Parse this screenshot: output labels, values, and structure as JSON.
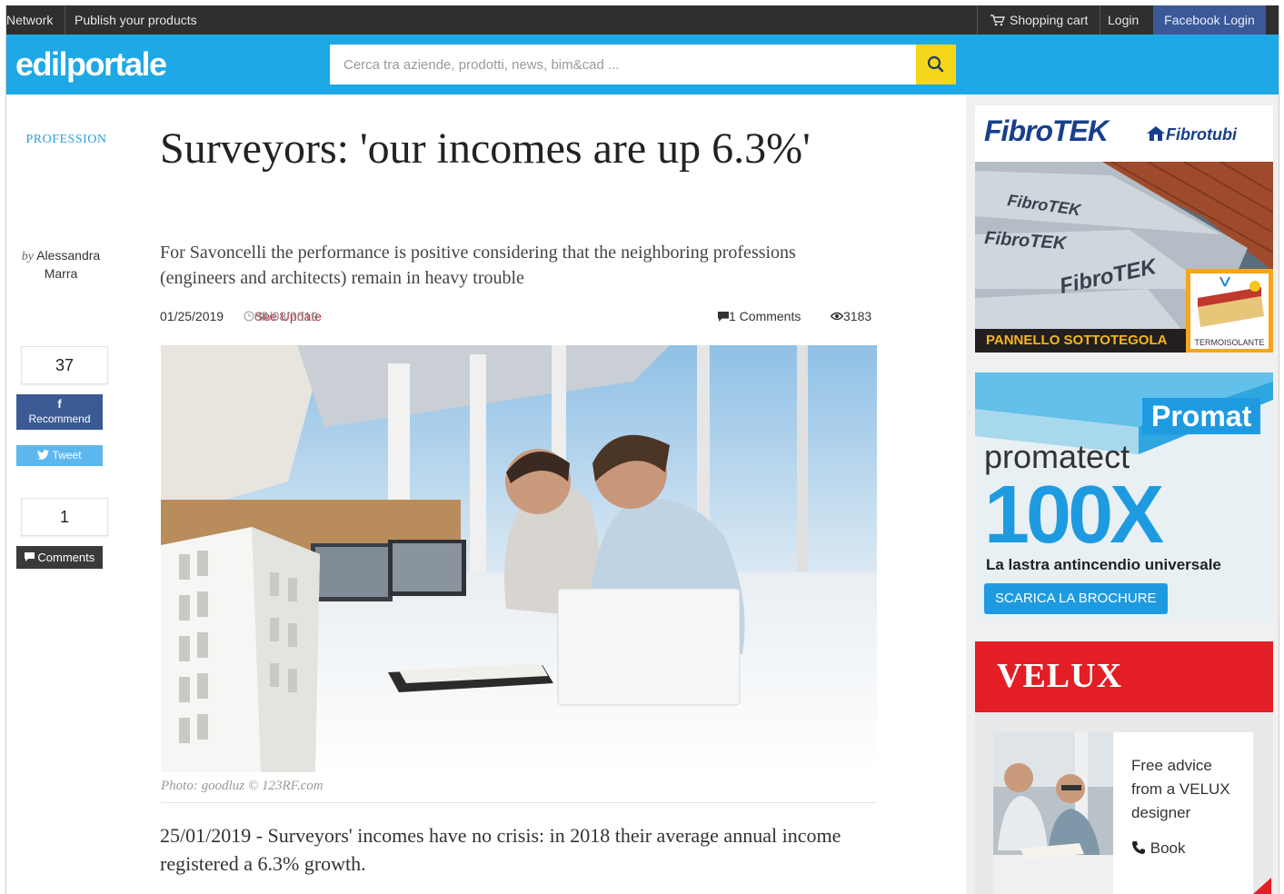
{
  "topbar": {
    "network": "Network",
    "publish": "Publish your products",
    "cart": "Shopping cart",
    "login": "Login",
    "facebook_login": "Facebook Login"
  },
  "header": {
    "logo": "edilportale",
    "search_placeholder": "Cerca tra aziende, prodotti, news, bim&cad ..."
  },
  "article": {
    "category": "PROFESSION",
    "author_by": "by",
    "author_name": "Alessandra Marra",
    "title": "Surveyors: 'our incomes are up 6.3%'",
    "subtitle": "For Savoncelli the performance is positive considering that the neighboring professions (engineers and architects) remain in heavy trouble",
    "date": "01/25/2019",
    "see_update": "See Update",
    "update_of": "of",
    "update_date": "04/08/2019",
    "comments_label": "1 Comments",
    "views": "3183",
    "photo_caption": "Photo: goodluz © 123RF.com",
    "lead": "25/01/2019 - Surveyors' incomes have no crisis: in 2018 their average annual income registered a 6.3% growth."
  },
  "social": {
    "share_count": "37",
    "recommend_label": "Recommend",
    "tweet_label": "Tweet",
    "comment_count": "1",
    "comments_label": "Comments"
  },
  "ads": {
    "fibrotek_brand": "FibroTEK",
    "fibrotubi_brand": "Fibrotubi",
    "fibrotek_product": "PANNELLO SOTTOTEGOLA",
    "fibrotek_badge": "TERMOISOLANTE",
    "panel_print_1": "FibroTEK",
    "panel_print_2": "FibroTEK",
    "panel_print_3": "FibroTEK",
    "promat_brand": "Promat",
    "promat_product": "promatect",
    "promat_model": "100X",
    "promat_tagline": "La lastra antincendio universale",
    "promat_cta": "SCARICA LA BROCHURE",
    "velux_brand": "VELUX",
    "velux_text_1": "Free advice",
    "velux_text_2": "from a VELUX",
    "velux_text_3": "designer",
    "velux_book": "Book"
  },
  "colors": {
    "header_blue": "#1ea8e6",
    "search_button": "#f5d61a",
    "facebook": "#3b5998",
    "twitter": "#5cb7ee",
    "update_red": "#c8202f",
    "velux_red": "#e31e24",
    "promat_blue": "#1e9be0"
  }
}
